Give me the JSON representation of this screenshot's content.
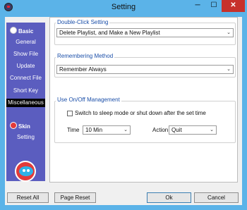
{
  "window": {
    "title": "Setting"
  },
  "title_controls": {
    "minimize": "─",
    "maximize": "☐",
    "close": "✕"
  },
  "sidebar": {
    "groups": [
      {
        "label": "Basic",
        "items": [
          "General",
          "Show File",
          "Update",
          "Connect File",
          "Short Key",
          "Miscellaneous"
        ]
      },
      {
        "label": "Skin",
        "items": [
          "Setting"
        ]
      }
    ],
    "selected": "Miscellaneous"
  },
  "double_click": {
    "title": "Double-Click Setting",
    "value": "Delete Playlist, and Make a New Playlist"
  },
  "remembering": {
    "title": "Remembering Method",
    "value": "Remember Always"
  },
  "onoff": {
    "title": "Use On/Off Management",
    "checkbox_label": "Switch to sleep mode or shut down after the set time",
    "checked": false,
    "time_label": "Time",
    "time_value": "10 Min",
    "action_label": "Action",
    "action_value": "Quit"
  },
  "buttons": {
    "reset_all": "Reset All",
    "page_reset": "Page Reset",
    "ok": "Ok",
    "cancel": "Cancel"
  },
  "icons": {
    "app": "app-icon",
    "basic": "basic-icon",
    "skin": "skin-icon",
    "mascot": "mascot-icon",
    "dropdown": "chevron-down-icon"
  },
  "colors": {
    "sidebar": "#5b5dbf",
    "selected": "#000000",
    "group_title": "#1a4ea8",
    "window_frame": "#5bb3e8",
    "close_button": "#c7312b"
  }
}
